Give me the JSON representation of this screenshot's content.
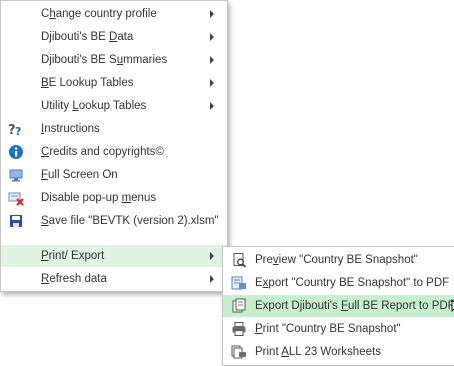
{
  "main_menu": {
    "items": [
      {
        "pre": "C",
        "u": "h",
        "post": "ange country profile",
        "icon": "none",
        "submenu": true
      },
      {
        "pre": "Djibouti's BE ",
        "u": "D",
        "post": "ata",
        "icon": "none",
        "submenu": true
      },
      {
        "pre": "Djibouti's BE S",
        "u": "u",
        "post": "mmaries",
        "icon": "none",
        "submenu": true
      },
      {
        "pre": "",
        "u": "B",
        "post": "E Lookup Tables",
        "icon": "none",
        "submenu": true
      },
      {
        "pre": "Utility ",
        "u": "L",
        "post": "ookup Tables",
        "icon": "none",
        "submenu": true
      },
      {
        "pre": "",
        "u": "I",
        "post": "nstructions",
        "icon": "help-icon",
        "submenu": false
      },
      {
        "pre": "",
        "u": "C",
        "post": "redits and copyrights©",
        "icon": "info-icon",
        "submenu": false
      },
      {
        "pre": "",
        "u": "F",
        "post": "ull Screen On",
        "icon": "fullscreen-icon",
        "submenu": false
      },
      {
        "pre": "Disable pop-up ",
        "u": "m",
        "post": "enus",
        "icon": "disable-popup-icon",
        "submenu": false
      },
      {
        "pre": "",
        "u": "S",
        "post": "ave file \"BEVTK (version 2).xlsm\"",
        "icon": "save-icon",
        "submenu": false
      },
      {
        "pre": "",
        "u": "P",
        "post": "rint/ Export",
        "icon": "none",
        "submenu": true
      },
      {
        "pre": "",
        "u": "R",
        "post": "efresh data",
        "icon": "none",
        "submenu": true
      }
    ]
  },
  "submenu": {
    "items": [
      {
        "pre": "Pre",
        "u": "v",
        "post": "iew \"Country BE Snapshot\"",
        "icon": "preview-icon"
      },
      {
        "pre": "E",
        "u": "x",
        "post": "port \"Country BE Snapshot\" to PDF",
        "icon": "export-pdf-icon"
      },
      {
        "pre": "Export Djibouti's ",
        "u": "F",
        "post": "ull BE Report to PDF",
        "icon": "export-report-icon"
      },
      {
        "pre": "",
        "u": "P",
        "post": "rint \"Country BE Snapshot\"",
        "icon": "printer-icon"
      },
      {
        "pre": "Print ",
        "u": "A",
        "post": "LL 23 Worksheets",
        "icon": "print-all-icon"
      }
    ]
  },
  "colors": {
    "highlight": "#c6efce",
    "selected": "#dff3e2",
    "text": "#333333"
  }
}
